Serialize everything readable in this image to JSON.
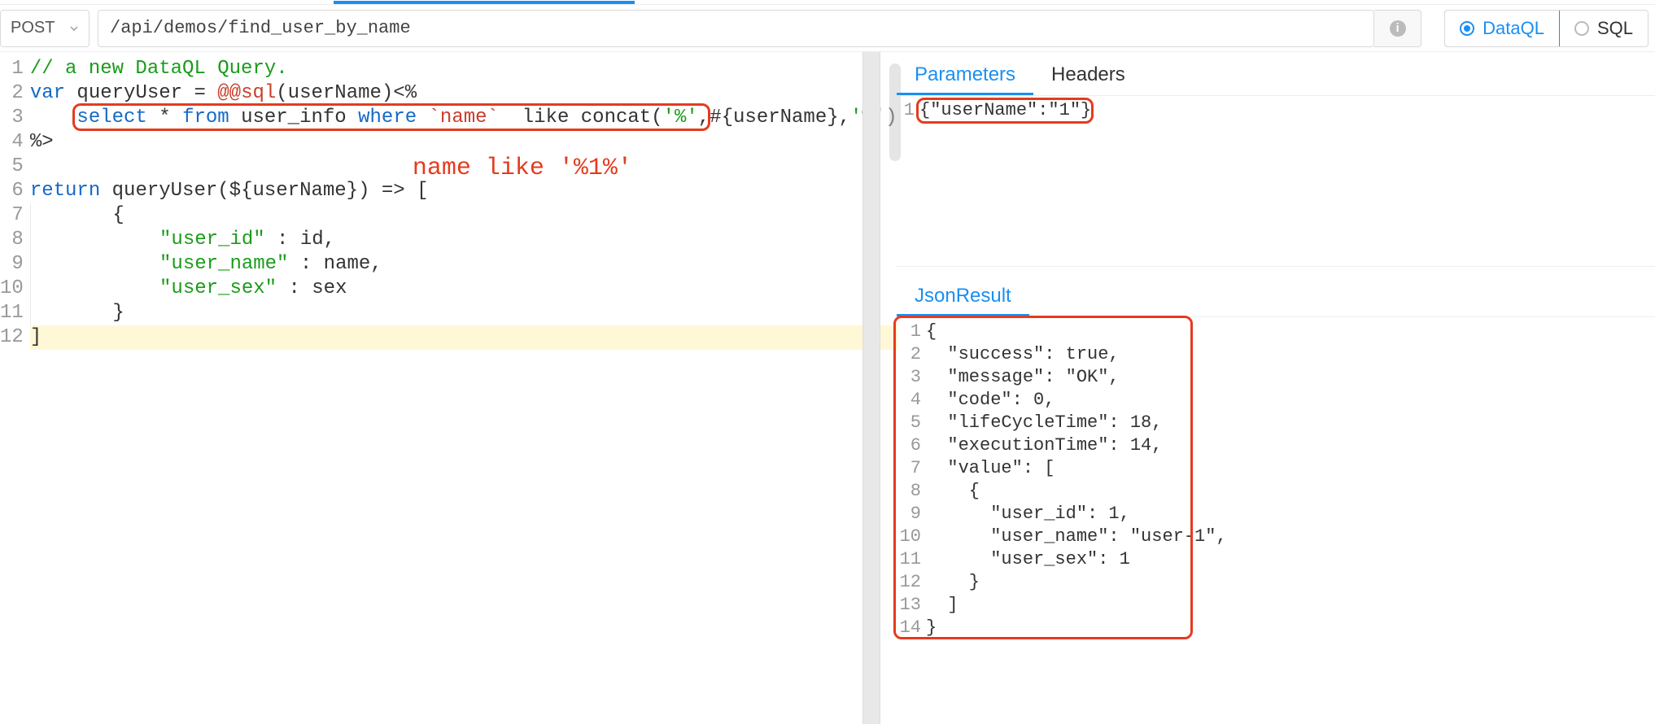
{
  "toolbar": {
    "method": "POST",
    "url": "/api/demos/find_user_by_name",
    "mode_options": [
      {
        "label": "DataQL",
        "selected": true
      },
      {
        "label": "SQL",
        "selected": false
      }
    ]
  },
  "editor": {
    "line_numbers": [
      "1",
      "2",
      "3",
      "4",
      "5",
      "6",
      "7",
      "8",
      "9",
      "10",
      "11",
      "12"
    ],
    "lines": {
      "l1_comment": "// a new DataQL Query.",
      "l2_var": "var",
      "l2_name": " queryUser = ",
      "l2_fn": "@@sql",
      "l2_args": "(userName)<%",
      "l3_pad": "    ",
      "l3_kw1": "select",
      "l3_mid1": " * ",
      "l3_kw2": "from",
      "l3_mid2": " user_info ",
      "l3_kw3": "where",
      "l3_mid3": " ",
      "l3_qcol": "`name`",
      "l3_mid4": "  like concat(",
      "l3_s1": "'%'",
      "l3_mid5": ",#{userName},",
      "l3_s2": "'%'",
      "l3_mid6": ")",
      "l4": "%>",
      "l5": "",
      "l6_kw": "return",
      "l6_rest": " queryUser(${userName}) => [",
      "l7": "    {",
      "l8_k": "\"user_id\"",
      "l8_rest": " : id,",
      "l9_k": "\"user_name\"",
      "l9_rest": " : name,",
      "l10_k": "\"user_sex\"",
      "l10_rest": " : sex",
      "l11": "    }",
      "l12": "]"
    },
    "annotation": "name like '%1%'"
  },
  "params_panel": {
    "tabs": [
      {
        "label": "Parameters",
        "active": true
      },
      {
        "label": "Headers",
        "active": false
      }
    ],
    "line_numbers": [
      "1"
    ],
    "body": "{\"userName\":\"1\"}"
  },
  "result_panel": {
    "tab_label": "JsonResult",
    "line_numbers": [
      "1",
      "2",
      "3",
      "4",
      "5",
      "6",
      "7",
      "8",
      "9",
      "10",
      "11",
      "12",
      "13",
      "14"
    ],
    "lines": [
      "{",
      "  \"success\": true,",
      "  \"message\": \"OK\",",
      "  \"code\": 0,",
      "  \"lifeCycleTime\": 18,",
      "  \"executionTime\": 14,",
      "  \"value\": [",
      "    {",
      "      \"user_id\": 1,",
      "      \"user_name\": \"user-1\",",
      "      \"user_sex\": 1",
      "    }",
      "  ]",
      "}"
    ]
  }
}
